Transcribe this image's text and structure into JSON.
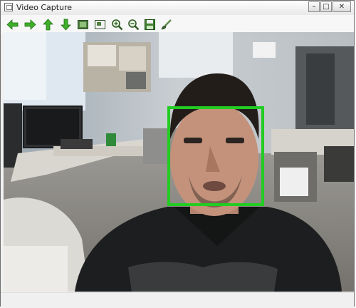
{
  "window": {
    "title": "Video Capture"
  },
  "controls": {
    "minimize": "–",
    "maximize": "□",
    "close": "✕"
  },
  "toolbar": {
    "buttons": [
      {
        "name": "back-arrow-icon"
      },
      {
        "name": "forward-arrow-icon"
      },
      {
        "name": "up-arrow-icon"
      },
      {
        "name": "down-arrow-icon"
      },
      {
        "name": "fit-window-icon"
      },
      {
        "name": "original-size-icon"
      },
      {
        "name": "zoom-in-icon"
      },
      {
        "name": "zoom-out-icon"
      },
      {
        "name": "save-icon"
      },
      {
        "name": "properties-brush-icon"
      }
    ]
  },
  "video": {
    "detection_color": "#22cc22"
  }
}
